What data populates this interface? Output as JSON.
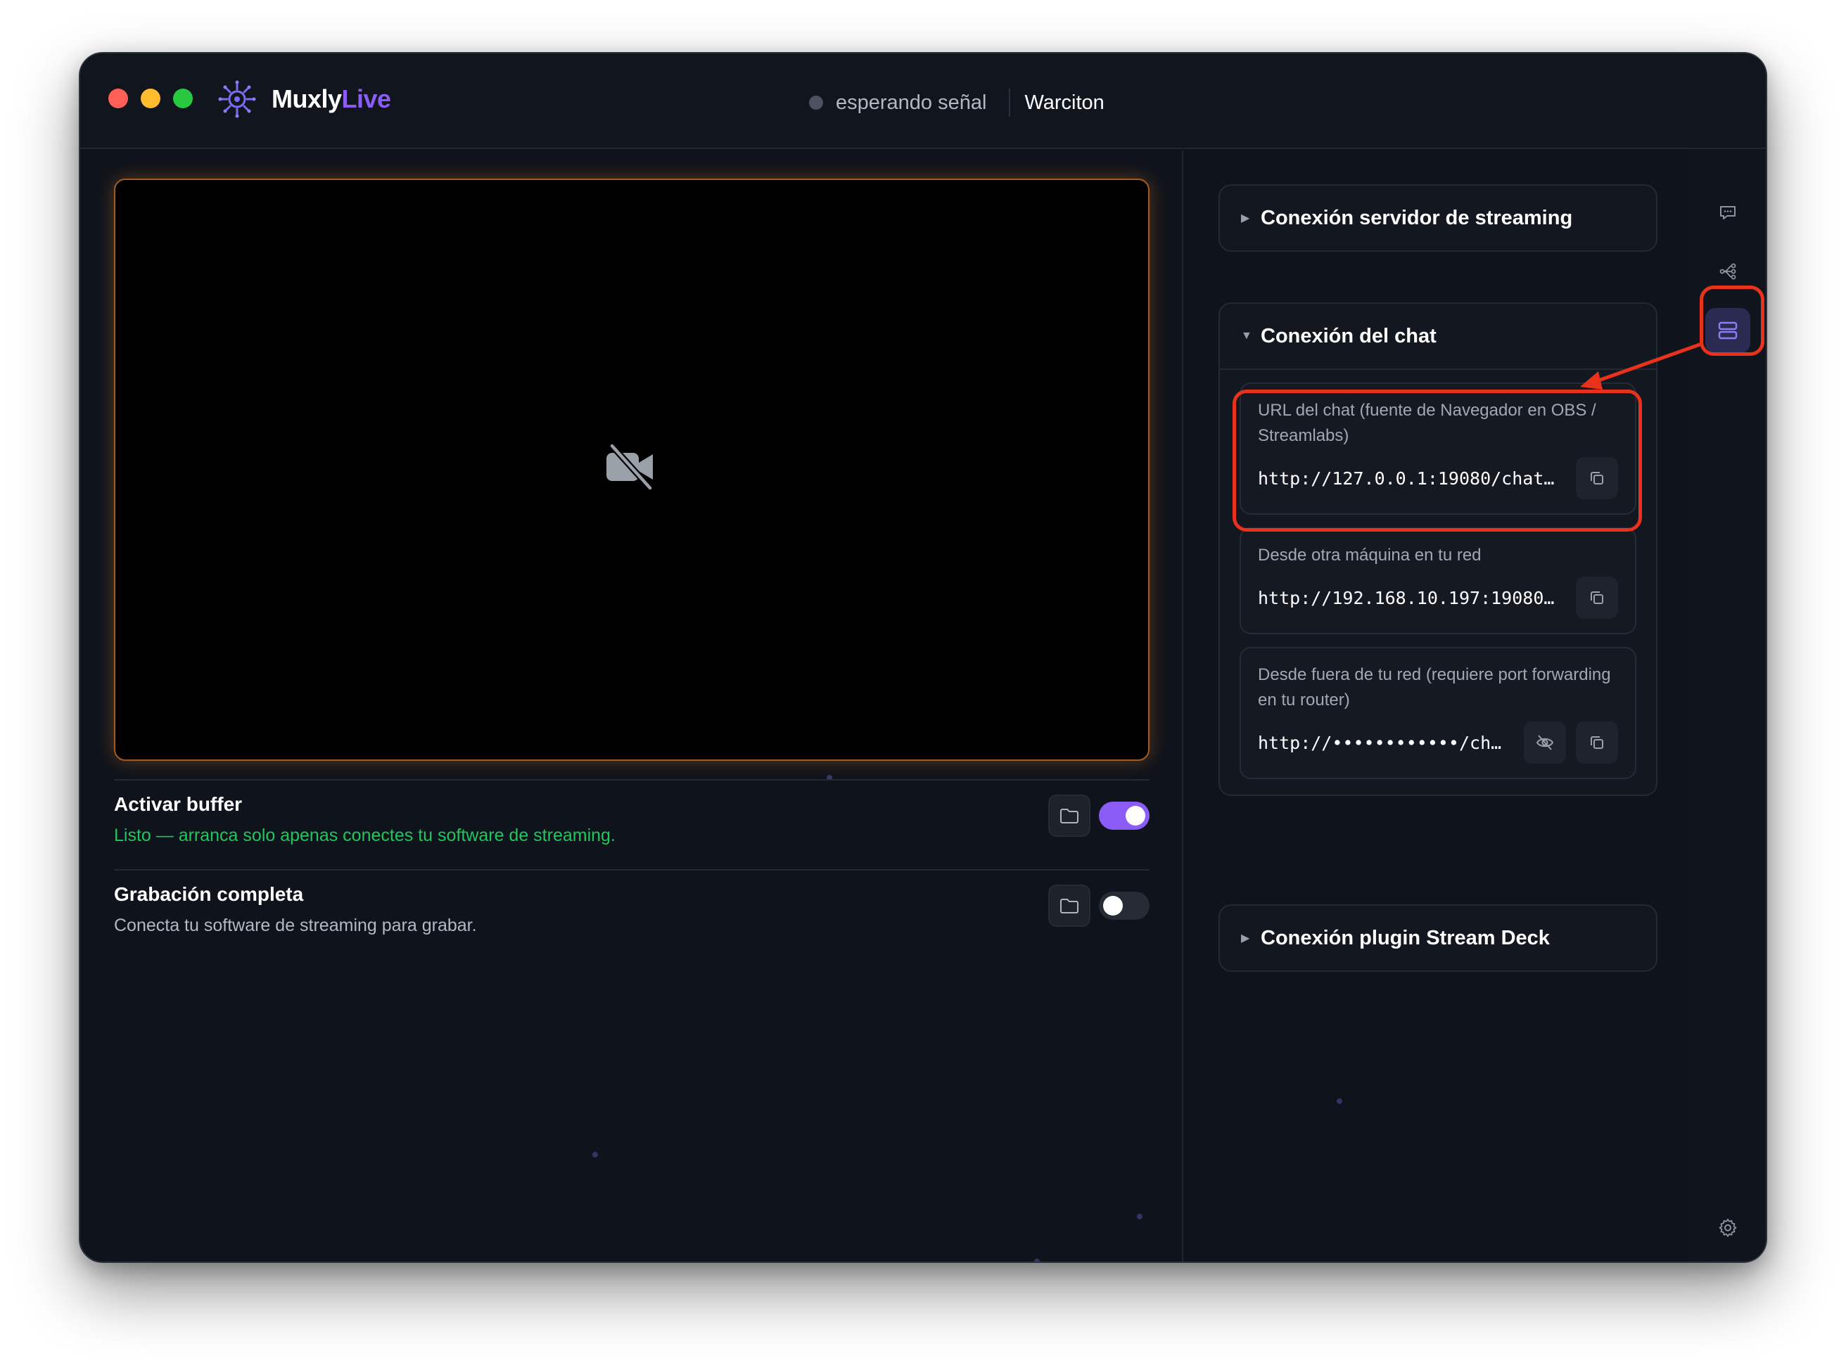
{
  "app": {
    "brand_part1": "Muxly",
    "brand_part2": "Live",
    "status_text": "esperando señal",
    "channel_name": "Warciton"
  },
  "colors": {
    "accent": "#8b5cf6",
    "success": "#22c55e",
    "highlight": "#e8321c",
    "preview_glow": "#d6782a"
  },
  "icons": {
    "logo": "muxly-logo-icon",
    "preview": "video-off-icon",
    "folder": "folder-icon",
    "copy": "copy-icon",
    "eye_off": "eye-off-icon",
    "chat": "chat-bubble-icon",
    "flow": "flow-icon",
    "server": "server-icon",
    "settings": "gear-icon"
  },
  "buffer": {
    "title": "Activar buffer",
    "subtitle": "Listo — arranca solo apenas conectes tu software de streaming.",
    "enabled": true
  },
  "recording": {
    "title": "Grabación completa",
    "subtitle": "Conecta tu software de streaming para grabar.",
    "enabled": false
  },
  "sections": {
    "streaming_server": {
      "title": "Conexión servidor de streaming",
      "expanded": false
    },
    "chat": {
      "title": "Conexión del chat",
      "expanded": true,
      "urls": [
        {
          "label": "URL del chat (fuente de Navegador en OBS / Streamlabs)",
          "value": "http://127.0.0.1:19080/chat…"
        },
        {
          "label": "Desde otra máquina en tu red",
          "value": "http://192.168.10.197:19080…"
        },
        {
          "label": "Desde fuera de tu red (requiere port forwarding en tu router)",
          "value": "http://••••••••••••/ch…"
        }
      ]
    },
    "stream_deck": {
      "title": "Conexión plugin Stream Deck",
      "expanded": false
    }
  }
}
